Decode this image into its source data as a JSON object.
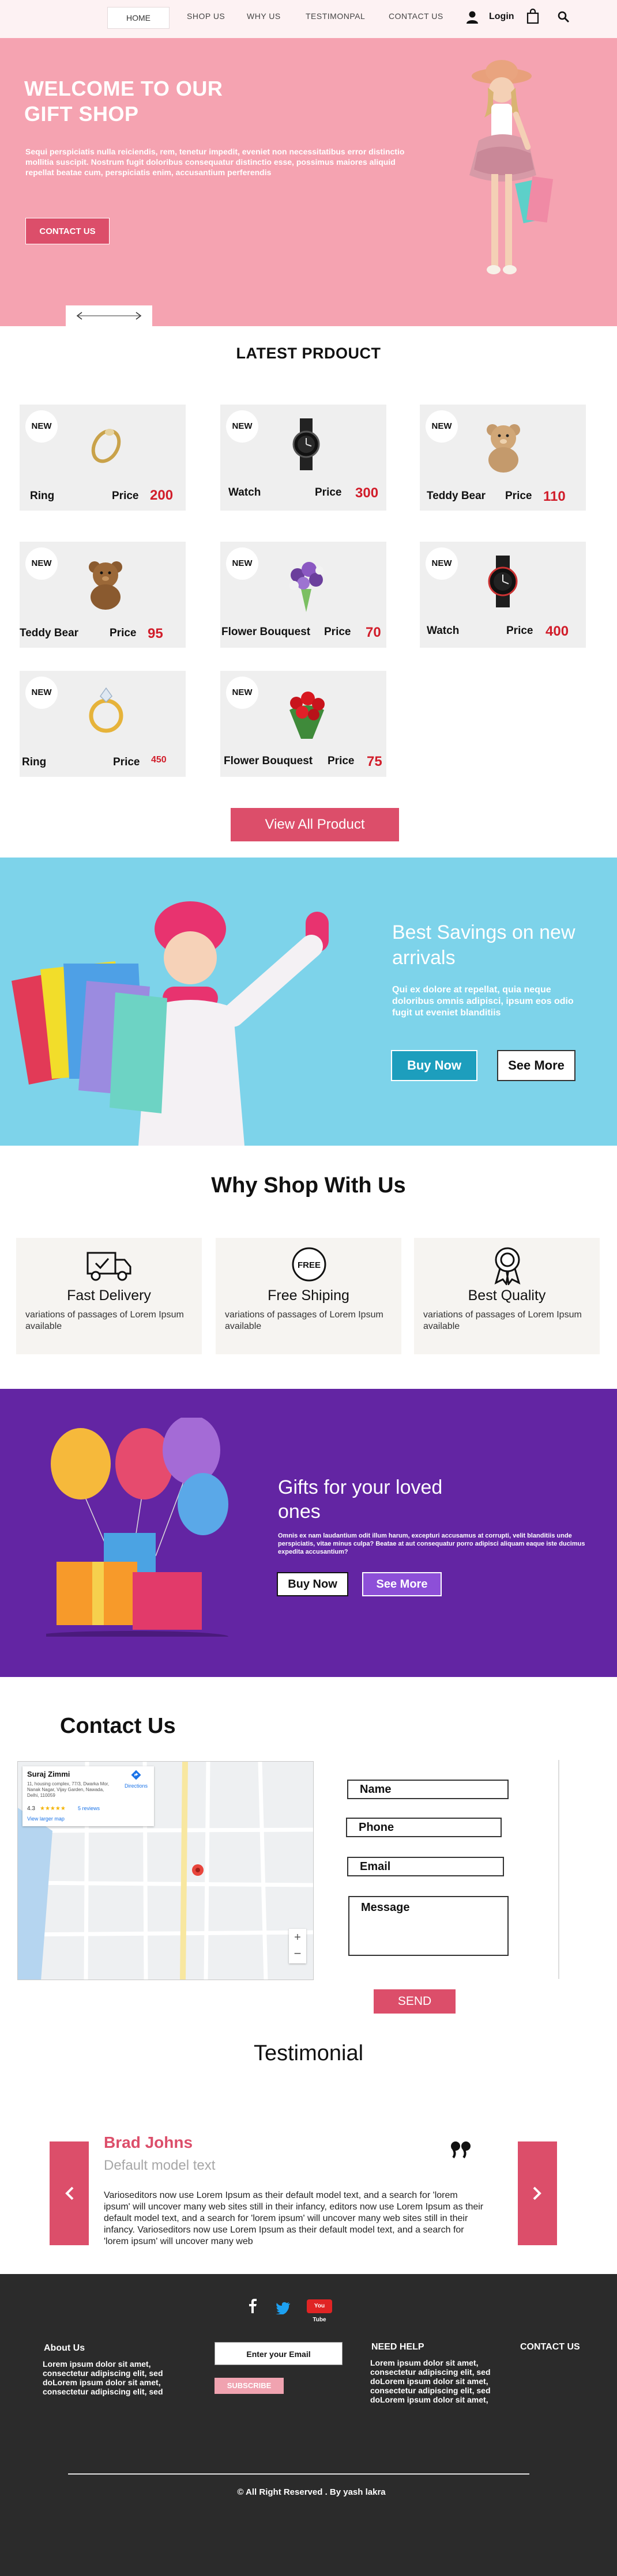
{
  "nav": {
    "items": [
      "HOME",
      "SHOP US",
      "WHY US",
      "TESTIMONPAL",
      "CONTACT US"
    ],
    "login": "Login"
  },
  "hero": {
    "title": "WELCOME TO OUR GIFT SHOP",
    "text": "Sequi perspiciatis nulla reiciendis, rem, tenetur impedit, eveniet non necessitatibus error distinctio mollitia suscipit. Nostrum fugit doloribus consequatur distinctio esse, possimus maiores aliquid repellat beatae cum, perspiciatis enim, accusantium perferendis",
    "button": "CONTACT US"
  },
  "products": {
    "title": "LATEST PRDOUCT",
    "badge": "NEW",
    "price_label": "Price",
    "items": [
      {
        "name": "Ring",
        "price": "200",
        "icon": "ring-icon"
      },
      {
        "name": "Watch",
        "price": "300",
        "icon": "watch-icon"
      },
      {
        "name": "Teddy Bear",
        "price": "110",
        "icon": "teddy-bear-icon"
      },
      {
        "name": "Teddy Bear",
        "price": "95",
        "icon": "teddy-bear-icon"
      },
      {
        "name": "Flower Bouquest",
        "price": "70",
        "icon": "bouquet-icon"
      },
      {
        "name": "Watch",
        "price": "400",
        "icon": "watch-icon"
      },
      {
        "name": "Ring",
        "price": "450",
        "icon": "ring-icon"
      },
      {
        "name": "Flower Bouquest",
        "price": "75",
        "icon": "roses-icon"
      }
    ],
    "view_all": "View All Product"
  },
  "savings": {
    "title": "Best Savings on new arrivals",
    "text": "Qui ex dolore at repellat, quia neque doloribus omnis adipisci, ipsum eos odio fugit ut eveniet blanditiis",
    "buy_now": "Buy Now",
    "see_more": "See More"
  },
  "why": {
    "title": "Why Shop With Us",
    "items": [
      {
        "title": "Fast Delivery",
        "text": "variations of passages of Lorem Ipsum available",
        "icon": "truck-icon"
      },
      {
        "title": "Free Shiping",
        "text": "variations of passages of Lorem Ipsum available",
        "icon": "free-badge-icon"
      },
      {
        "title": "Best Quality",
        "text": "variations of passages of Lorem Ipsum available",
        "icon": "award-icon"
      }
    ]
  },
  "gifts": {
    "title": "Gifts for your loved ones",
    "text": "Omnis ex nam laudantium odit illum harum, excepturi accusamus at corrupti, velit blanditiis unde perspiciatis, vitae minus culpa? Beatae at aut consequatur porro adipisci aliquam eaque iste ducimus expedita accusantium?",
    "buy_now": "Buy Now",
    "see_more": "See More"
  },
  "contact": {
    "title": "Contact Us",
    "map": {
      "place": "Suraj Zimmi",
      "address": "11, housing complex, 77/3, Dwarka Mor, Nanak Nagar, Vijay Garden, Nawada, Delhi, 110059",
      "rating": "4.3",
      "reviews": "5 reviews",
      "larger_map": "View larger map",
      "directions": "Directions"
    },
    "fields": {
      "name": "Name",
      "phone": "Phone",
      "email": "Email",
      "message": "Message"
    },
    "send": "SEND"
  },
  "testimonial": {
    "title": "Testimonial",
    "name": "Brad Johns",
    "role": "Default model text",
    "quote": "Varioseditors now use Lorem Ipsum as their default model text, and a search for 'lorem ipsum' will uncover many web sites still in their infancy, editors now use Lorem Ipsum as their default model text, and a search for 'lorem ipsum' will uncover many web sites still in their infancy. Varioseditors now use Lorem Ipsum as their default model text, and a search for 'lorem ipsum' will uncover many web"
  },
  "footer": {
    "about_title": "About Us",
    "about_text": "Lorem ipsum dolor sit amet, consectetur adipiscing elit, sed doLorem ipsum dolor sit amet, consectetur adipiscing elit, sed",
    "email_placeholder": "Enter your Email",
    "subscribe": "SUBSCRIBE",
    "help_title": "NEED HELP",
    "help_text": "Lorem ipsum dolor sit amet, consectetur adipiscing elit, sed doLorem ipsum dolor sit amet, consectetur adipiscing elit, sed doLorem ipsum dolor sit amet,",
    "contact_title": "CONTACT US",
    "copyright": "All Right Reserved . By yash lakra",
    "social": {
      "youtube": "You Tube"
    }
  },
  "colors": {
    "accent": "#dc4e6a",
    "hero_bg": "#f5a3b1",
    "savings_bg": "#7dd3ea",
    "gifts_bg": "#6325a3",
    "price_red": "#d11d2a",
    "footer_bg": "#2b2b2b"
  }
}
